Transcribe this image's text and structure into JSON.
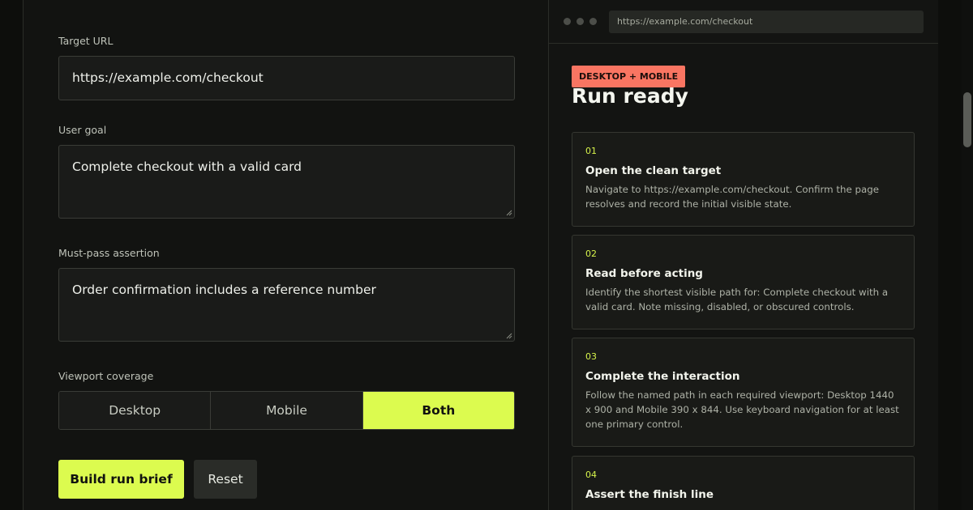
{
  "form": {
    "target_url": {
      "label": "Target URL",
      "value": "https://example.com/checkout"
    },
    "user_goal": {
      "label": "User goal",
      "value": "Complete checkout with a valid card"
    },
    "assertion": {
      "label": "Must-pass assertion",
      "value": "Order confirmation includes a reference number"
    },
    "viewport": {
      "label": "Viewport coverage",
      "options": [
        "Desktop",
        "Mobile",
        "Both"
      ],
      "selected": "Both"
    },
    "build_label": "Build run brief",
    "reset_label": "Reset"
  },
  "preview": {
    "url": "https://example.com/checkout",
    "badge": "DESKTOP + MOBILE",
    "title": "Run ready",
    "steps": [
      {
        "num": "01",
        "title": "Open the clean target",
        "desc": "Navigate to https://example.com/checkout. Confirm the page resolves and record the initial visible state."
      },
      {
        "num": "02",
        "title": "Read before acting",
        "desc": "Identify the shortest visible path for: Complete checkout with a valid card. Note missing, disabled, or obscured controls."
      },
      {
        "num": "03",
        "title": "Complete the interaction",
        "desc": "Follow the named path in each required viewport: Desktop 1440 x 900 and Mobile 390 x 844. Use keyboard navigation for at least one primary control."
      },
      {
        "num": "04",
        "title": "Assert the finish line",
        "desc": ""
      }
    ]
  },
  "colors": {
    "accent": "#dcfb4f",
    "badge": "#f97562",
    "background": "#121311"
  }
}
